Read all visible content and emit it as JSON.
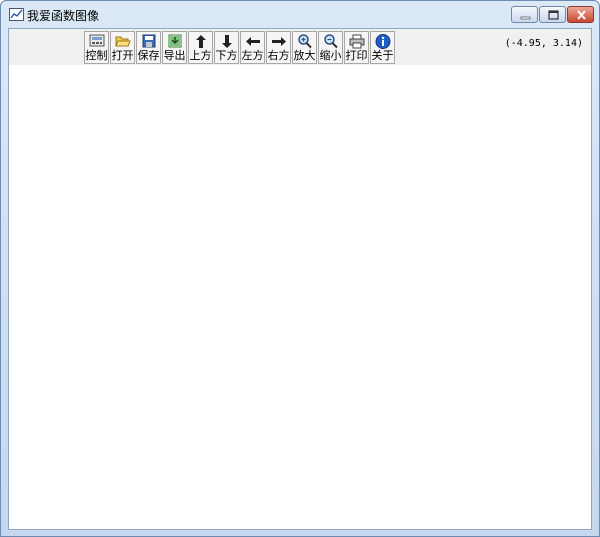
{
  "window": {
    "title": "我爱函数图像"
  },
  "toolbar": {
    "buttons": [
      {
        "label": "控制",
        "icon": "control-panel-icon"
      },
      {
        "label": "打开",
        "icon": "folder-open-icon"
      },
      {
        "label": "保存",
        "icon": "floppy-disk-icon"
      },
      {
        "label": "导出",
        "icon": "export-image-icon"
      },
      {
        "label": "上方",
        "icon": "arrow-up-icon"
      },
      {
        "label": "下方",
        "icon": "arrow-down-icon"
      },
      {
        "label": "左方",
        "icon": "arrow-left-icon"
      },
      {
        "label": "右方",
        "icon": "arrow-right-icon"
      },
      {
        "label": "放大",
        "icon": "zoom-in-icon"
      },
      {
        "label": "缩小",
        "icon": "zoom-out-icon"
      },
      {
        "label": "打印",
        "icon": "printer-icon"
      },
      {
        "label": "关于",
        "icon": "info-icon"
      }
    ]
  },
  "status": {
    "coordinates": "(-4.95, 3.14)"
  },
  "colors": {
    "toolbar_bg": "#f0f0f0",
    "title_bar": "#c6d8ee",
    "canvas": "#ffffff",
    "info_blue": "#1f5fc4"
  }
}
